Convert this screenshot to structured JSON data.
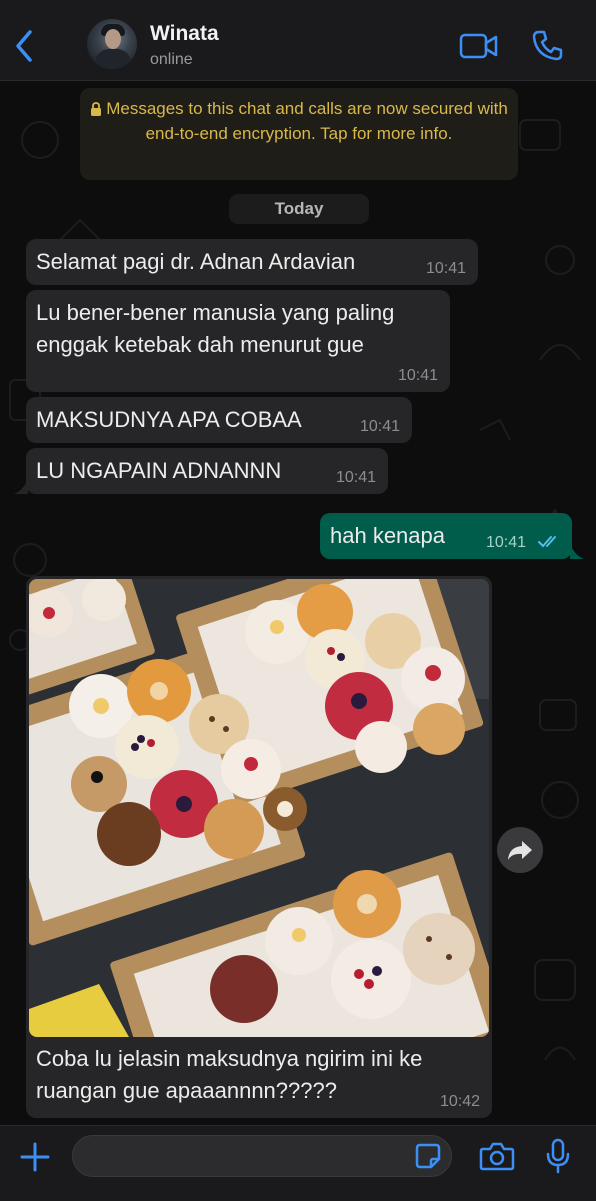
{
  "header": {
    "contact_name": "Winata",
    "status": "online"
  },
  "encryption_notice": "Messages to this chat and calls are now secured with end-to-end encryption. Tap for more info.",
  "date_divider": "Today",
  "messages": [
    {
      "direction": "incoming",
      "text": "Selamat pagi dr. Adnan Ardavian",
      "time": "10:41"
    },
    {
      "direction": "incoming",
      "text_line1": "Lu bener-bener manusia yang paling",
      "text_line2": "enggak ketebak dah menurut gue",
      "time": "10:41"
    },
    {
      "direction": "incoming",
      "text": "MAKSUDNYA APA COBAA",
      "time": "10:41"
    },
    {
      "direction": "incoming",
      "text": "LU NGAPAIN ADNANNN",
      "time": "10:41"
    },
    {
      "direction": "outgoing",
      "text": "hah kenapa",
      "time": "10:41",
      "status": "read"
    },
    {
      "direction": "incoming",
      "type": "image",
      "caption_line1": "Coba lu jelasin maksudnya ngirim ini ke",
      "caption_line2": "ruangan gue apaaannnn?????",
      "time": "10:42"
    }
  ],
  "composer": {
    "value": "",
    "placeholder": ""
  },
  "colors": {
    "accent": "#3c8ff4",
    "incoming_bubble": "#262628",
    "outgoing_bubble": "#005c4b",
    "notice_text": "#d9b84a",
    "read_ticks": "#53bdeb"
  },
  "icons": [
    "chevron-left-icon",
    "video-icon",
    "phone-icon",
    "lock-icon",
    "double-check-icon",
    "forward-icon",
    "plus-icon",
    "sticker-icon",
    "camera-icon",
    "microphone-icon"
  ]
}
